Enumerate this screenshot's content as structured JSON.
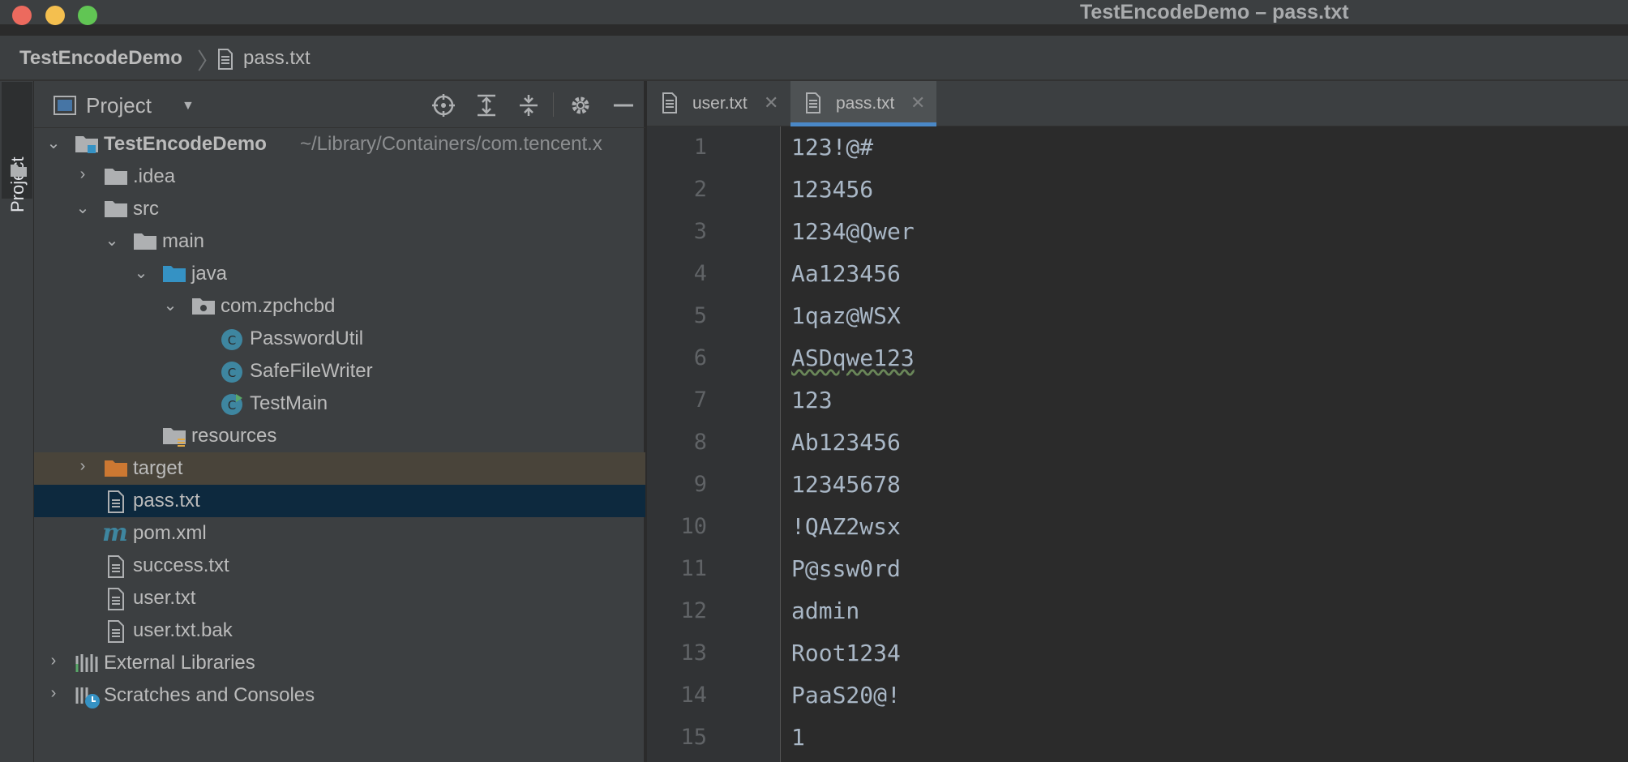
{
  "window": {
    "title": "TestEncodeDemo – pass.txt"
  },
  "breadcrumb": {
    "project": "TestEncodeDemo",
    "separator": "〉",
    "file": "pass.txt"
  },
  "tool_stripe": {
    "label": "Project"
  },
  "project_panel": {
    "title": "Project",
    "tools": [
      "locate-icon",
      "expand-all-icon",
      "collapse-all-icon",
      "gear-icon",
      "minimize-icon"
    ],
    "tree": [
      {
        "label": "TestEncodeDemo",
        "path": "~/Library/Containers/com.tencent.x",
        "icon": "module-folder-icon",
        "expanded": true
      },
      {
        "label": ".idea",
        "icon": "folder-icon",
        "expanded": false
      },
      {
        "label": "src",
        "icon": "folder-icon",
        "expanded": true
      },
      {
        "label": "main",
        "icon": "folder-icon",
        "expanded": true
      },
      {
        "label": "java",
        "icon": "source-folder-icon",
        "expanded": true
      },
      {
        "label": "com.zpchcbd",
        "icon": "package-icon",
        "expanded": true
      },
      {
        "label": "PasswordUtil",
        "icon": "class-icon"
      },
      {
        "label": "SafeFileWriter",
        "icon": "class-icon"
      },
      {
        "label": "TestMain",
        "icon": "runnable-class-icon"
      },
      {
        "label": "resources",
        "icon": "resources-folder-icon"
      },
      {
        "label": "target",
        "icon": "excluded-folder-icon",
        "expanded": false
      },
      {
        "label": "pass.txt",
        "icon": "text-file-icon",
        "selected": true
      },
      {
        "label": "pom.xml",
        "icon": "maven-icon"
      },
      {
        "label": "success.txt",
        "icon": "text-file-icon"
      },
      {
        "label": "user.txt",
        "icon": "text-file-icon"
      },
      {
        "label": "user.txt.bak",
        "icon": "text-file-icon"
      },
      {
        "label": "External Libraries",
        "icon": "libraries-icon",
        "expanded": false
      },
      {
        "label": "Scratches and Consoles",
        "icon": "scratches-icon",
        "expanded": false
      }
    ]
  },
  "editor": {
    "tabs": [
      {
        "label": "user.txt",
        "active": false
      },
      {
        "label": "pass.txt",
        "active": true
      }
    ],
    "line_numbers": [
      "1",
      "2",
      "3",
      "4",
      "5",
      "6",
      "7",
      "8",
      "9",
      "10",
      "11",
      "12",
      "13",
      "14",
      "15"
    ],
    "lines": [
      "123!@#",
      "123456",
      "1234@Qwer",
      "Aa123456",
      "1qaz@WSX",
      "ASDqwe123",
      "123",
      "Ab123456",
      "12345678",
      "!QAZ2wsx",
      "P@ssw0rd",
      "admin",
      "Root1234",
      "PaaS20@!",
      "1"
    ]
  },
  "colors": {
    "accent": "#4a88c7",
    "selection": "#0d293e",
    "excluded_bg": "#49443a",
    "editor_bg": "#2b2b2b",
    "panel_bg": "#3c3f41"
  }
}
